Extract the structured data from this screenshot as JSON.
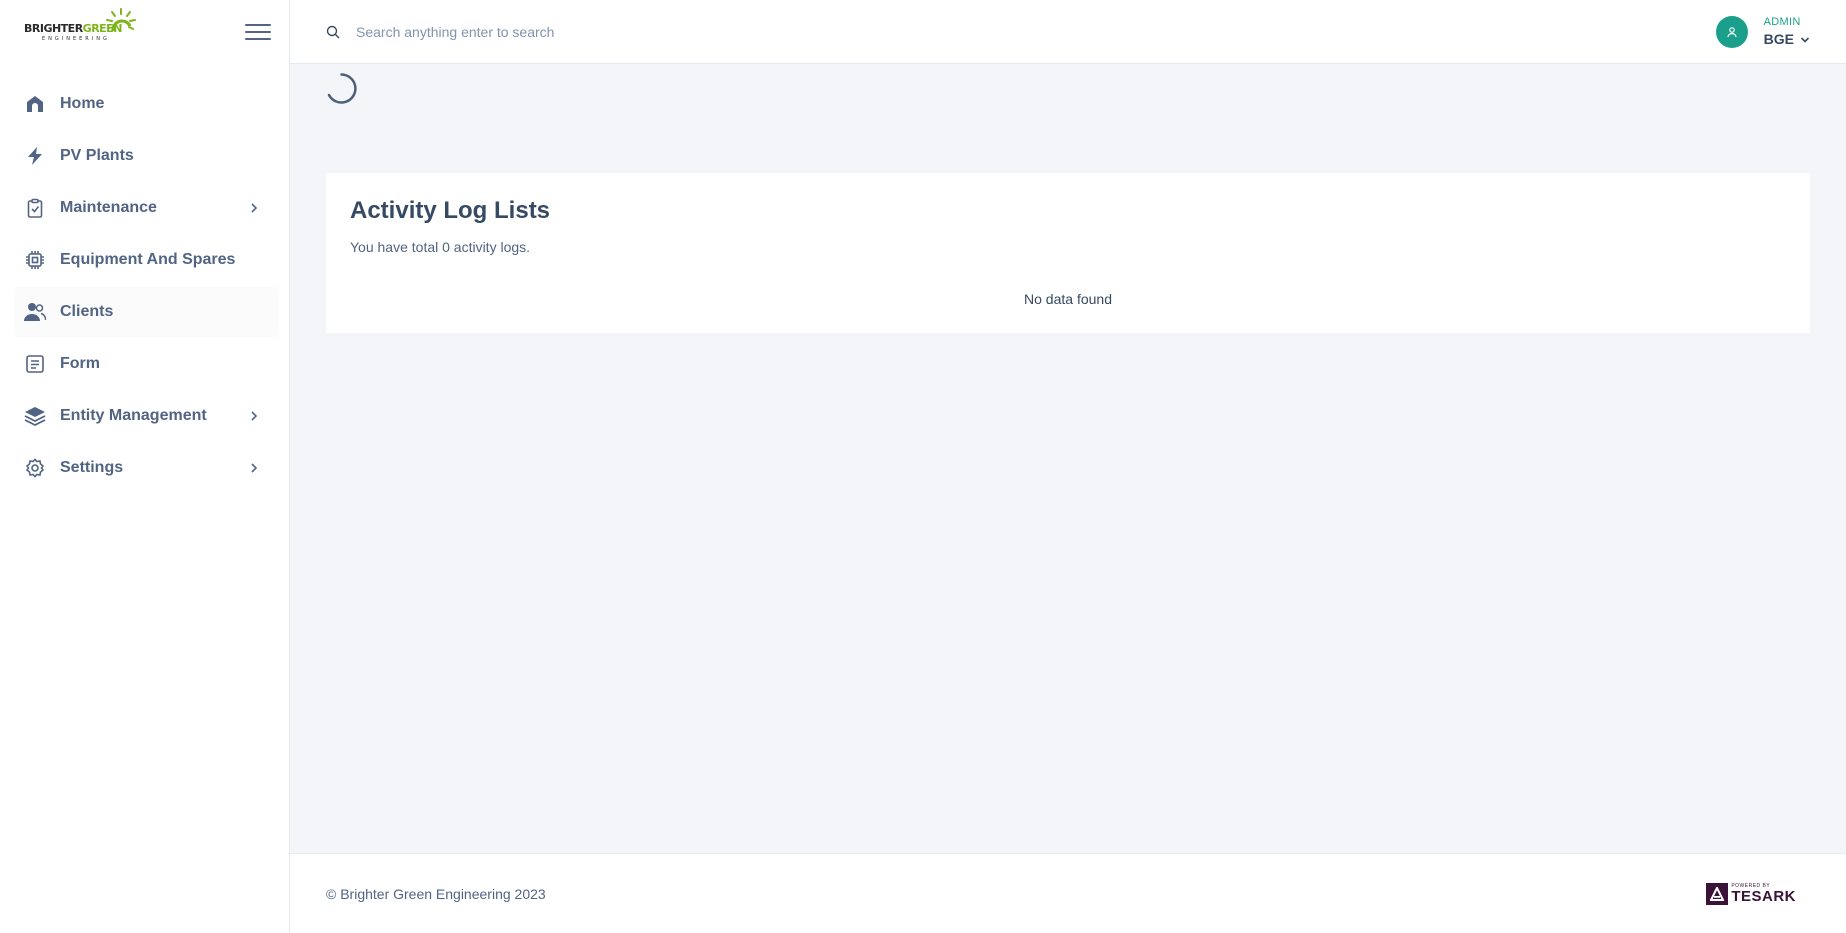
{
  "brand": {
    "logo_word1": "BRIGHTER",
    "logo_word2": "GREEN",
    "logo_sub": "ENGINEERING",
    "logo_color": "#7cb518"
  },
  "sidebar": {
    "items": [
      {
        "label": "Home",
        "icon": "home-icon",
        "has_submenu": false,
        "active": false
      },
      {
        "label": "PV Plants",
        "icon": "bolt-icon",
        "has_submenu": false,
        "active": false
      },
      {
        "label": "Maintenance",
        "icon": "clipboard-check-icon",
        "has_submenu": true,
        "active": false
      },
      {
        "label": "Equipment And Spares",
        "icon": "chip-icon",
        "has_submenu": false,
        "active": false
      },
      {
        "label": "Clients",
        "icon": "users-icon",
        "has_submenu": false,
        "active": true
      },
      {
        "label": "Form",
        "icon": "form-icon",
        "has_submenu": false,
        "active": false
      },
      {
        "label": "Entity Management",
        "icon": "layers-icon",
        "has_submenu": true,
        "active": false
      },
      {
        "label": "Settings",
        "icon": "gear-icon",
        "has_submenu": true,
        "active": false
      }
    ]
  },
  "header": {
    "search_placeholder": "Search anything enter to search",
    "user_role": "ADMIN",
    "user_name": "BGE",
    "accent_color": "#1aa08a"
  },
  "main": {
    "title": "Activity Log Lists",
    "subtitle": "You have total 0 activity logs.",
    "empty_text": "No data found"
  },
  "footer": {
    "copyright": "© Brighter Green Engineering 2023",
    "powered_small": "POWERED BY",
    "powered_brand": "TESARK"
  }
}
